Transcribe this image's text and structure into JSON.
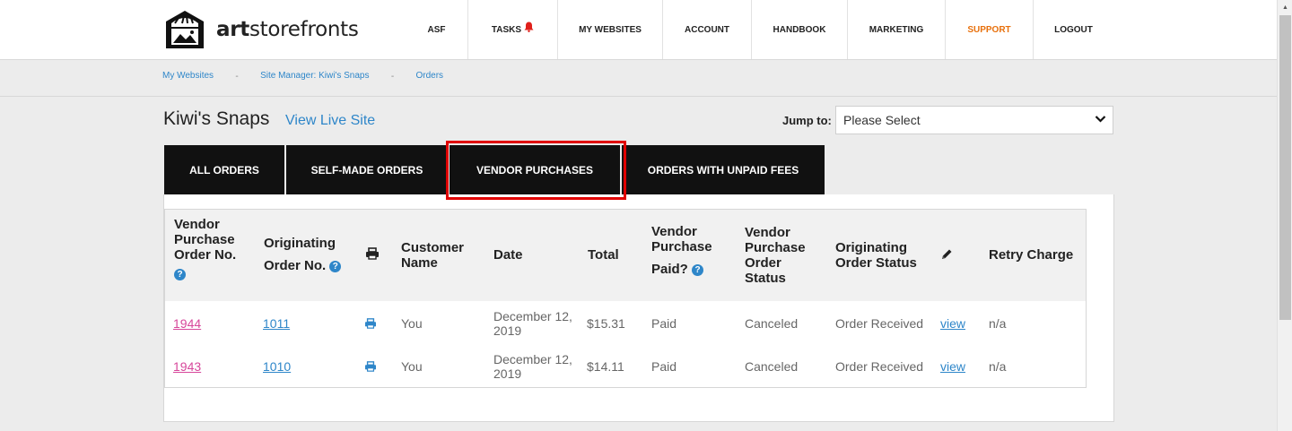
{
  "header": {
    "logo_bold": "art",
    "logo_rest": "storefronts",
    "nav": [
      {
        "label": "ASF",
        "width": 69
      },
      {
        "label": "TASKS",
        "width": 100,
        "bell": true
      },
      {
        "label": "MY WEBSITES",
        "width": 117
      },
      {
        "label": "ACCOUNT",
        "width": 99
      },
      {
        "label": "HANDBOOK",
        "width": 107
      },
      {
        "label": "MARKETING",
        "width": 109
      },
      {
        "label": "SUPPORT",
        "width": 98,
        "accent": true
      },
      {
        "label": "LOGOUT",
        "width": 90
      }
    ]
  },
  "breadcrumb": {
    "items": [
      "My Websites",
      "Site Manager: Kiwi's Snaps",
      "Orders"
    ],
    "separator": "-"
  },
  "page": {
    "title": "Kiwi's Snaps",
    "view_live": "View Live Site",
    "jump_label": "Jump to:",
    "jump_value": "Please Select"
  },
  "tabs": [
    "ALL ORDERS",
    "SELF-MADE ORDERS",
    "VENDOR PURCHASES",
    "ORDERS WITH UNPAID FEES"
  ],
  "table": {
    "headers": {
      "vendor_order_no": [
        "Vendor",
        "Purchase",
        "Order No."
      ],
      "originating_order_no": [
        "Originating",
        "Order No."
      ],
      "customer_name": [
        "Customer",
        "Name"
      ],
      "date": "Date",
      "total": "Total",
      "vendor_paid": [
        "Vendor",
        "Purchase",
        "Paid?"
      ],
      "vendor_status": [
        "Vendor",
        "Purchase",
        "Order",
        "Status"
      ],
      "originating_status": [
        "Originating",
        "Order Status"
      ],
      "retry_charge": "Retry Charge"
    },
    "rows": [
      {
        "vendor_no": "1944",
        "orig_no": "1011",
        "customer": "You",
        "date": [
          "December 12,",
          "2019"
        ],
        "total": "$15.31",
        "paid": "Paid",
        "vendor_status": "Canceled",
        "orig_status": "Order Received",
        "action": "view",
        "retry": "n/a"
      },
      {
        "vendor_no": "1943",
        "orig_no": "1010",
        "customer": "You",
        "date": [
          "December 12,",
          "2019"
        ],
        "total": "$14.11",
        "paid": "Paid",
        "vendor_status": "Canceled",
        "orig_status": "Order Received",
        "action": "view",
        "retry": "n/a"
      }
    ]
  },
  "icons": {
    "help": "?",
    "printer": "printer-icon",
    "pencil": "pencil-icon",
    "bell": "bell-icon",
    "select_chevron": "chevron-down-icon"
  },
  "colors": {
    "accent_orange": "#e8700c",
    "link_blue": "#2e86c9",
    "link_pink": "#d7479b",
    "highlight_red": "#e00000",
    "tab_black": "#111111"
  }
}
